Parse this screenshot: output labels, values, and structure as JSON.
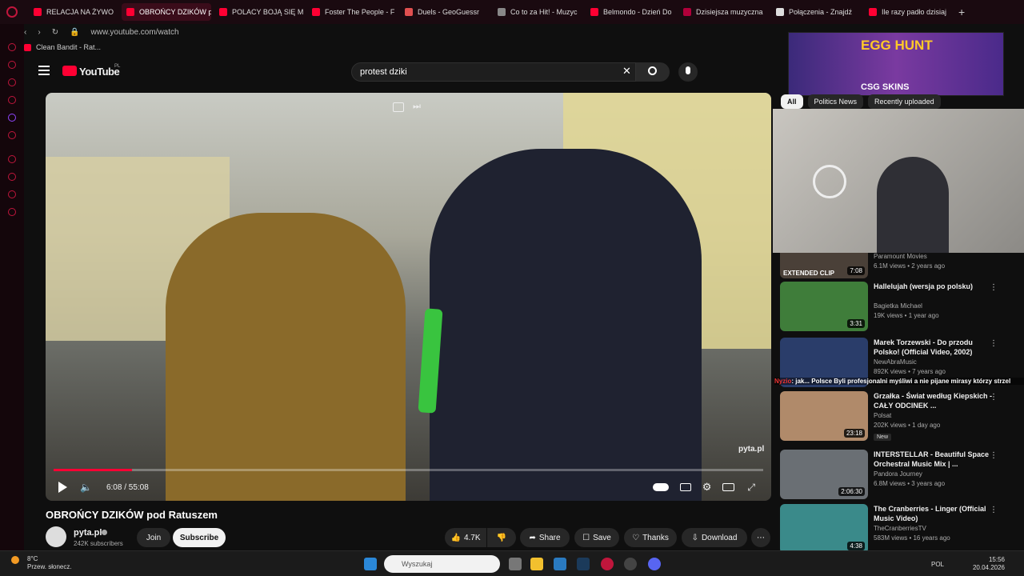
{
  "tabs": [
    {
      "label": "RELACJA NA ŻYWO",
      "active": false,
      "color": "#ff0033"
    },
    {
      "label": "OBROŃCY DZIKÓW pod R",
      "active": true,
      "color": "#ff0033"
    },
    {
      "label": "POLACY BOJĄ SIĘ M",
      "active": false,
      "color": "#ff0033"
    },
    {
      "label": "Foster The People - F",
      "active": false,
      "color": "#ff0033"
    },
    {
      "label": "Duels - GeoGuessr",
      "active": false,
      "color": "#e05050"
    },
    {
      "label": "Co to za Hit! - Muzyc",
      "active": false,
      "color": "#888888"
    },
    {
      "label": "Belmondo - Dzień Do",
      "active": false,
      "color": "#ff0033"
    },
    {
      "label": "Dzisiejsza muzyczna",
      "active": false,
      "color": "#b0003a"
    },
    {
      "label": "Połączenia - Znajdź",
      "active": false,
      "color": "#dddddd"
    },
    {
      "label": "Ile razy padło dzisiaj",
      "active": false,
      "color": "#ff0033"
    }
  ],
  "browser": {
    "url": "www.youtube.com/watch",
    "bookmark": "Clean Bandit - Rat..."
  },
  "youtube": {
    "logo": "YouTube",
    "region": "PL",
    "search_value": "protest dziki"
  },
  "player": {
    "time": "6:08 / 55:08",
    "progress": 0.11,
    "watermark": "pyta.pl"
  },
  "video": {
    "title": "OBROŃCY DZIKÓW pod Ratuszem"
  },
  "channel": {
    "name": "pyta.pl",
    "subscribers": "242K subscribers",
    "join": "Join",
    "subscribe": "Subscribe"
  },
  "actions": {
    "likes": "4.7K",
    "share": "Share",
    "save": "Save",
    "thanks": "Thanks",
    "download": "Download"
  },
  "ad": {
    "title": "EGG HUNT",
    "brand": "CSG SKINS"
  },
  "chips": [
    "All",
    "Politics News",
    "Recently uploaded"
  ],
  "first_partial": {
    "channel": "Paramount Movies",
    "meta": "6.1M views • 2 years ago",
    "duration": "7:08",
    "overlay": "EXTENDED CLIP"
  },
  "recommendations": [
    {
      "title": "Hallelujah (wersja po polsku)",
      "channel": "Bagietka Michael",
      "meta": "19K views • 1 year ago",
      "duration": "3:31",
      "thumb": "#3f7d3a"
    },
    {
      "title": "Marek Torzewski - Do przodu Polsko! (Official Video, 2002)",
      "channel": "NewAbraMusic",
      "meta": "892K views • 7 years ago",
      "duration": "",
      "thumb": "#2a3d6a"
    },
    {
      "title": "Grzałka - Świat według Kiepskich - CAŁY ODCINEK ...",
      "channel": "Polsat",
      "meta": "202K views • 1 day ago",
      "duration": "23:18",
      "thumb": "#b08a6a",
      "badge": "New"
    },
    {
      "title": "INTERSTELLAR - Beautiful Space Orchestral Music Mix | ...",
      "channel": "Pandora Journey",
      "meta": "6.8M views • 3 years ago",
      "duration": "2:06:30",
      "thumb": "#6a6f74"
    },
    {
      "title": "The Cranberries - Linger (Official Music Video)",
      "channel": "TheCranberriesTV",
      "meta": "583M views • 16 years ago",
      "duration": "4:38",
      "thumb": "#3a8a8a"
    }
  ],
  "chat": {
    "user": "Nyzio",
    "message": ": jak... Polsce Byli profesjonalni myśliwi a nie pijane mirasy którzy strzel"
  },
  "taskbar": {
    "temp": "8°C",
    "weather": "Przew. słonecz.",
    "search": "Wyszukaj",
    "lang": "POL",
    "time": "15:56",
    "date": "20.04.2026"
  }
}
